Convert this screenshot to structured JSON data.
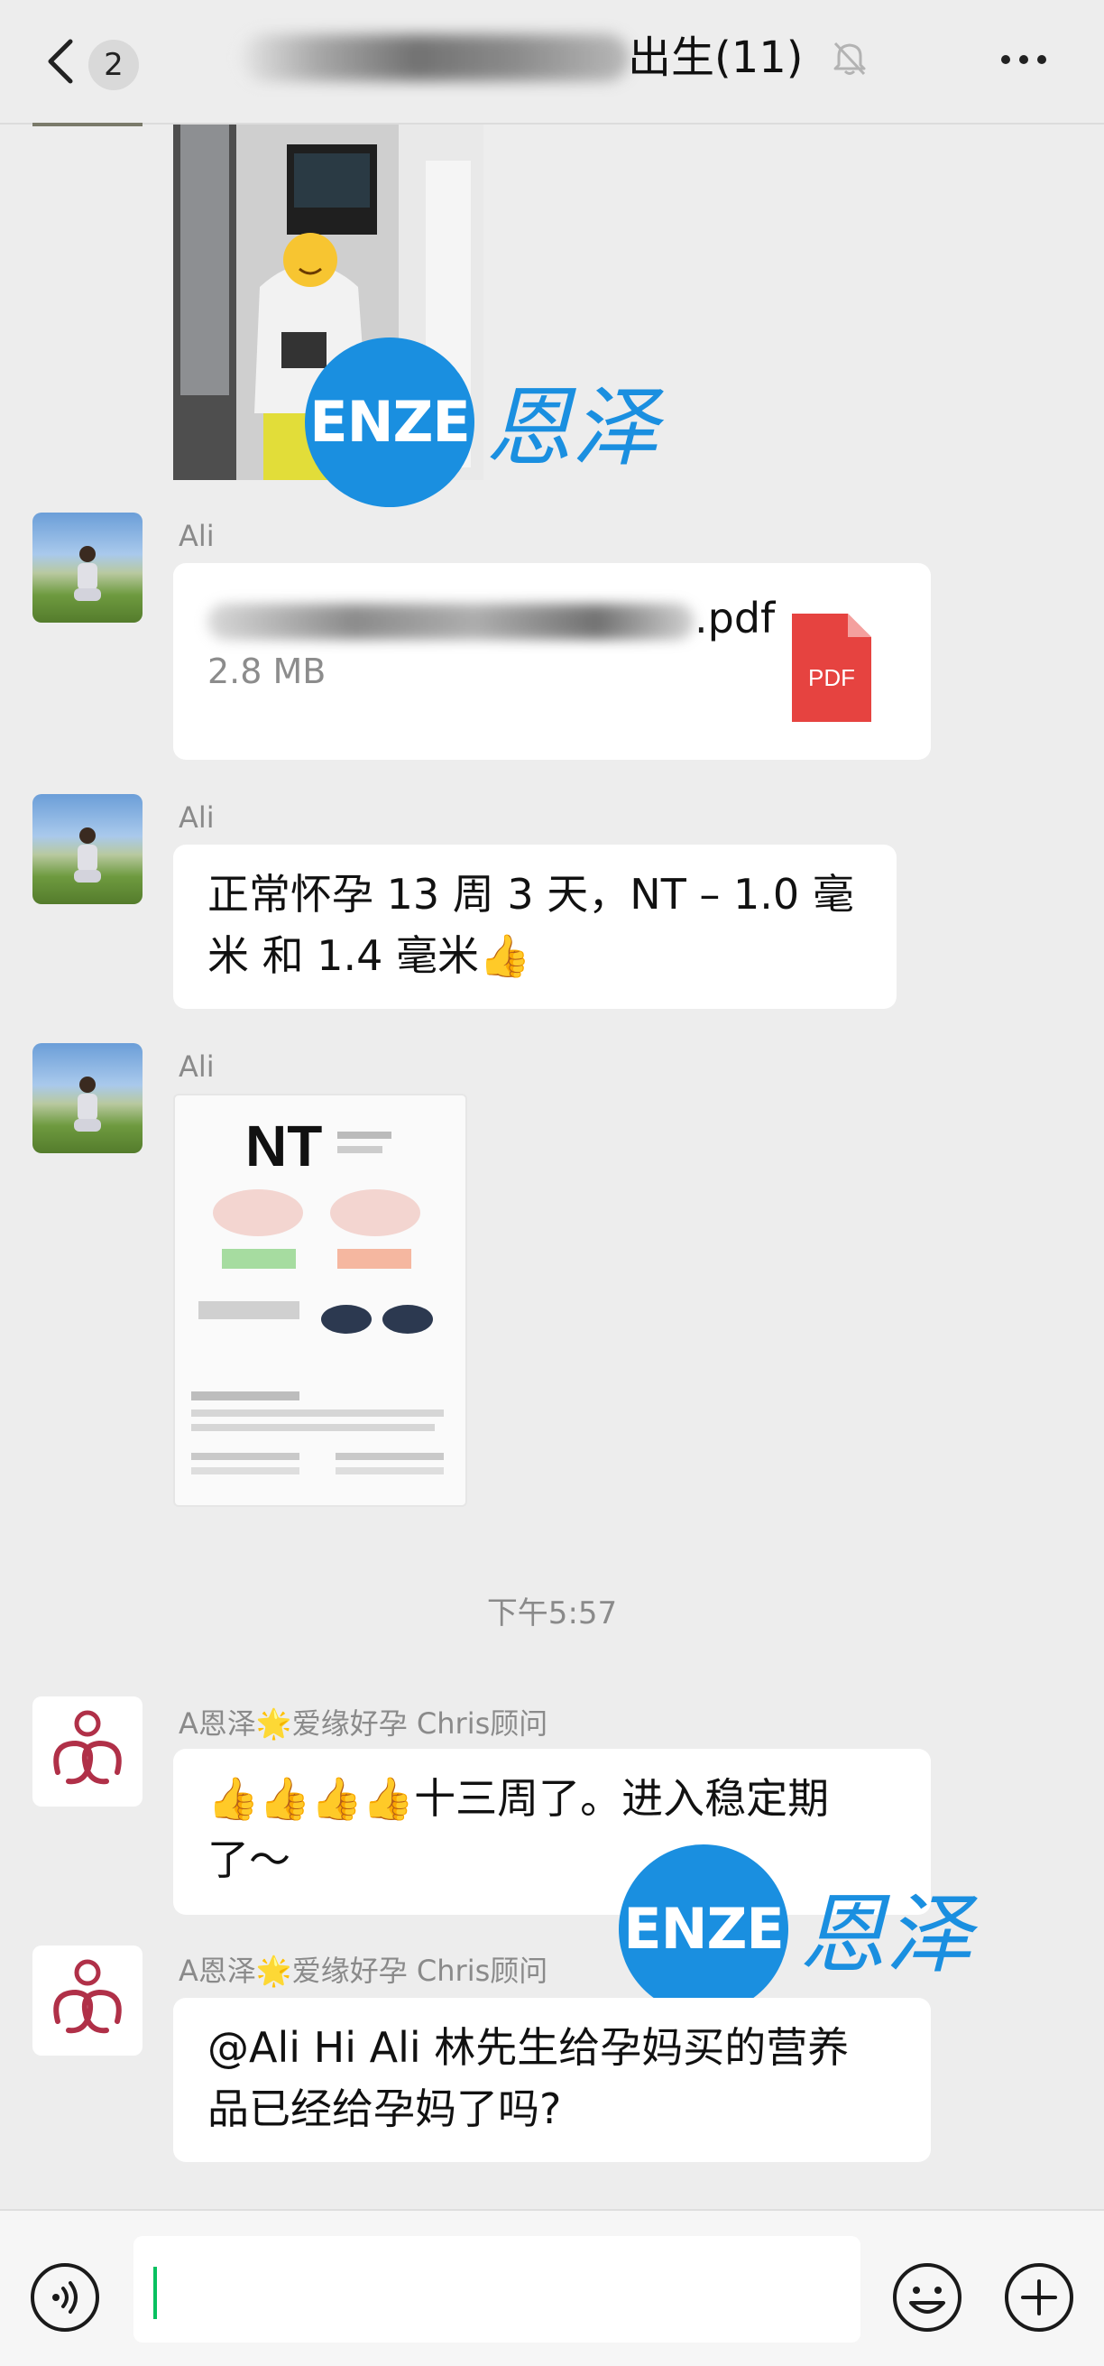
{
  "header": {
    "back_badge": "2",
    "title_visible": "出生(11)"
  },
  "messages": [
    {
      "sender": "Ali",
      "type": "file",
      "file_name_visible": ".pdf",
      "file_size": "2.8 MB",
      "file_icon_label": "PDF"
    },
    {
      "sender": "Ali",
      "type": "text",
      "lines": [
        "正常怀孕 13 周 3 天，NT – 1.0 毫",
        "米 和 1.4 毫米👍"
      ]
    },
    {
      "sender": "Ali",
      "type": "image",
      "card_title": "NT"
    },
    {
      "sender": "A恩泽🌟爱缘好孕 Chris顾问",
      "type": "text",
      "lines": [
        "👍👍👍👍十三周了。进入稳定期",
        "了～"
      ]
    },
    {
      "sender": "A恩泽🌟爱缘好孕 Chris顾问",
      "type": "text",
      "lines": [
        "@Ali Hi Ali 林先生给孕妈买的营养",
        "品已经给孕妈了吗?"
      ]
    }
  ],
  "timestamp": "下午5:57",
  "watermark": {
    "circle_text": "ENZE",
    "cn_text": "恩泽"
  },
  "input": {
    "value": ""
  },
  "colors": {
    "background": "#ededed",
    "bubble": "#ffffff",
    "watermark": "#1a8fe0",
    "pdf": "#e64340",
    "caret": "#07c160"
  }
}
